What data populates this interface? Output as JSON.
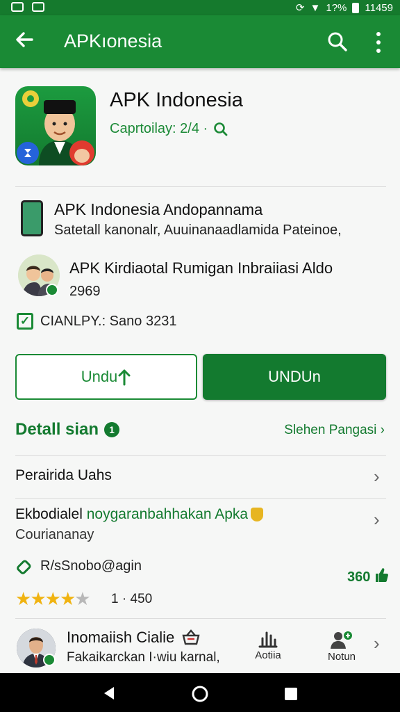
{
  "status_bar": {
    "left_icons": [
      "photo-icon",
      "gallery-icon"
    ],
    "signal": "1?%",
    "time": "11459"
  },
  "app_bar": {
    "title": "APKıonesia",
    "back_icon": "arrow-left-icon",
    "search_icon": "search-icon",
    "menu_icon": "more-vert-icon"
  },
  "app": {
    "title": "APK Indonesia",
    "meta": "Caprtoilay: 2/4 ·"
  },
  "developer": {
    "name": "APK Indonesia",
    "name_suffix": " Andopannama",
    "description": "Satetall kanonalr, Auuinanaadlamida Pateinoe,"
  },
  "recommendation": {
    "title": "APK Kirdiaotal Rumigan Inbraiiasi Aldo",
    "count": "2969"
  },
  "compat": {
    "text": "CIANLPY.: Sano 3231"
  },
  "buttons": {
    "secondary": "Undu",
    "primary": "UNDUn"
  },
  "details": {
    "title": "Detall sian",
    "badge": "1",
    "link": "Slehen Pangasi ›"
  },
  "rows": [
    {
      "label": "Perairida Uahs"
    },
    {
      "label_dark": "Ekbodialel ",
      "label_green": "noygaranbahhakan Apka",
      "sub": "Couriananay"
    }
  ],
  "stats": {
    "label": "R/sSnobo@agin",
    "value": "360",
    "rating": 4.5,
    "rating_count": "1 · 450"
  },
  "review": {
    "name": "Inomaiish Cialie",
    "text": "Fakaikarckan I·wiu karnal,",
    "actions": [
      "Aotiia",
      "Notun"
    ]
  },
  "colors": {
    "primary": "#1a8a35",
    "primary_dark": "#137a2f",
    "star": "#f0b311"
  }
}
